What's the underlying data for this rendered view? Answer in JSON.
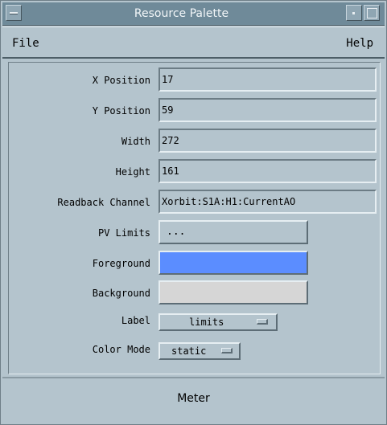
{
  "window": {
    "title": "Resource Palette"
  },
  "menubar": {
    "file": "File",
    "help": "Help"
  },
  "fields": {
    "x_position": {
      "label": "X Position",
      "value": "17"
    },
    "y_position": {
      "label": "Y Position",
      "value": "59"
    },
    "width": {
      "label": "Width",
      "value": "272"
    },
    "height": {
      "label": "Height",
      "value": "161"
    },
    "readback_channel": {
      "label": "Readback Channel",
      "value": "Xorbit:S1A:H1:CurrentAO"
    },
    "pv_limits": {
      "label": "PV Limits",
      "value": "..."
    },
    "foreground": {
      "label": "Foreground",
      "color": "#5b8dff"
    },
    "background": {
      "label": "Background",
      "color": "#d6d6d6"
    },
    "label": {
      "label": "Label",
      "value": "limits"
    },
    "color_mode": {
      "label": "Color Mode",
      "value": "static"
    }
  },
  "status": {
    "text": "Meter"
  }
}
